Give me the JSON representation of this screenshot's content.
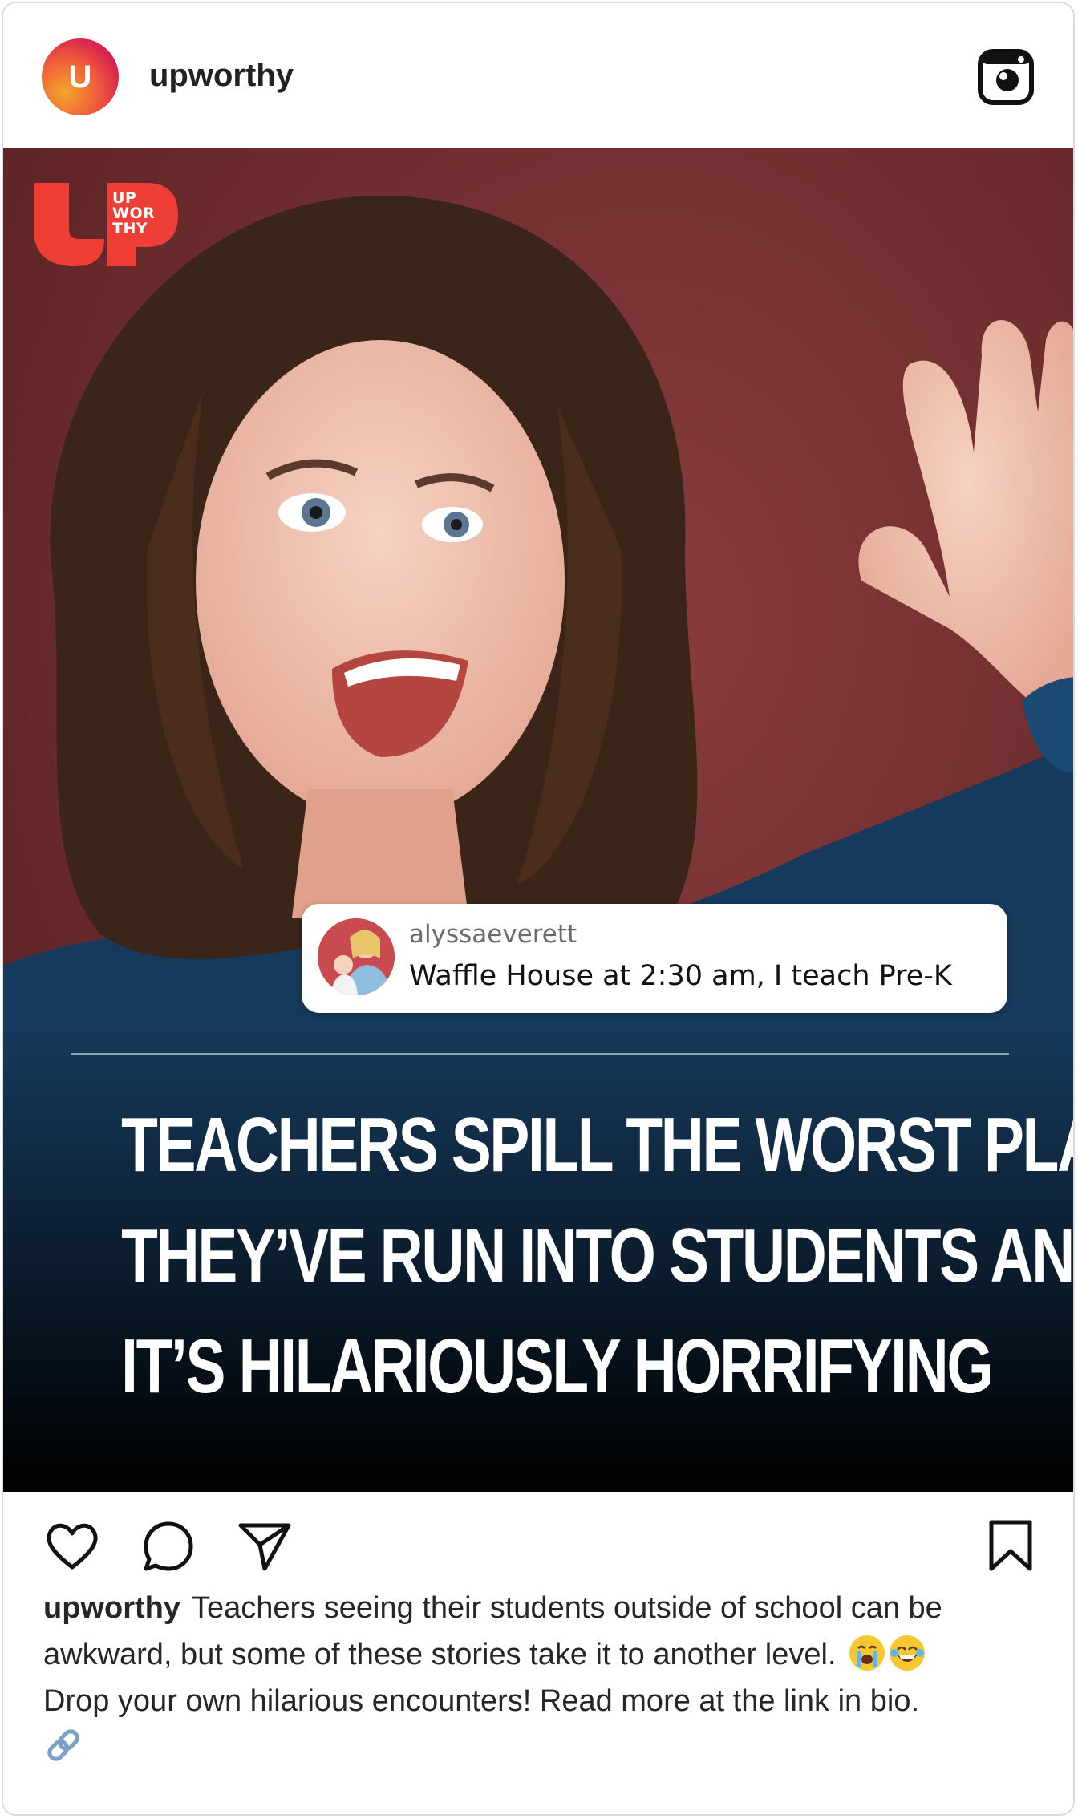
{
  "header": {
    "avatar_letter": "U",
    "username": "upworthy",
    "platform_icon": "instagram-icon"
  },
  "post_image": {
    "logo_text": "UP\nWOR\nTHY",
    "comment": {
      "user": "alyssaeverett",
      "text": "Waffle House at 2:30 am, I teach Pre-K"
    },
    "headline_lines": [
      "TEACHERS SPILL THE WORST PLACES",
      "THEY’VE RUN INTO STUDENTS AND",
      "IT’S HILARIOUSLY HORRIFYING"
    ]
  },
  "actions": {
    "like_icon": "heart-icon",
    "comment_icon": "comment-bubble-icon",
    "share_icon": "paper-plane-icon",
    "save_icon": "bookmark-icon"
  },
  "caption": {
    "username": "upworthy",
    "text_part1": "Teachers seeing their students outside of school can be awkward, but some of these stories take it to another level.",
    "emojis": [
      "😭",
      "😂"
    ],
    "text_part2": "Drop your own hilarious encounters! Read more at the link in bio.",
    "link_emoji": "🔗"
  },
  "colors": {
    "brand_red": "#ef3e36",
    "wall": "#7a3335",
    "text_dark": "#262626"
  }
}
